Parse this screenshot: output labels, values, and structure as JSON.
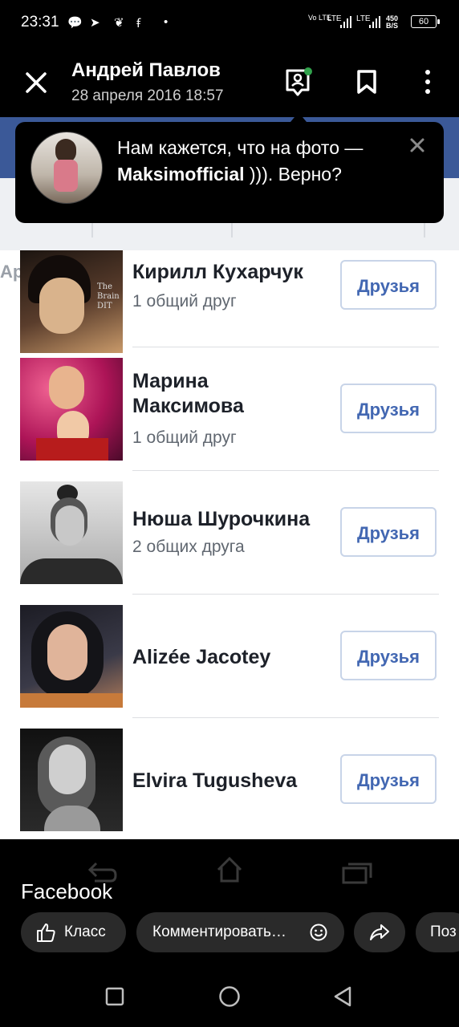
{
  "status_bar": {
    "time": "23:31",
    "network_left": "Vo LTE",
    "lte1": "LTE",
    "lte2": "LTE",
    "speed": "450 B/S",
    "battery": "60"
  },
  "header": {
    "author": "Андрей Павлов",
    "date": "28 апреля 2016 18:57"
  },
  "tooltip": {
    "text_prefix": "Нам кажется, что на фото — ",
    "tagged_name": "Maksimofficial",
    "text_suffix": " ))). Верно?"
  },
  "photo": {
    "tab_hint": "Ары",
    "friends": [
      {
        "name": "Кирилл Кухарчук",
        "mutual": "1 общий друг",
        "button": "Друзья",
        "avatar_color": "#3a2a22",
        "avatar_text": "The Brain DIT"
      },
      {
        "name": "Марина Максимова",
        "mutual": "1 общий друг",
        "button": "Друзья",
        "avatar_color": "#c2185b"
      },
      {
        "name": "Нюша Шурочкина",
        "mutual": "2 общих друга",
        "button": "Друзья",
        "avatar_color": "#bdbdbd"
      },
      {
        "name": "Alizée Jacotey",
        "mutual": "",
        "button": "Друзья",
        "avatar_color": "#2e2e36"
      },
      {
        "name": "Elvira Tugusheva",
        "mutual": "",
        "button": "Друзья",
        "avatar_color": "#1f1f1f"
      }
    ]
  },
  "bottom": {
    "source": "Facebook",
    "like_label": "Класс",
    "comment_label": "Комментировать…",
    "share_more_label": "Поз"
  },
  "colors": {
    "facebook_blue": "#3b5998",
    "link_blue": "#4267b2",
    "online_dot": "#31a24c"
  }
}
